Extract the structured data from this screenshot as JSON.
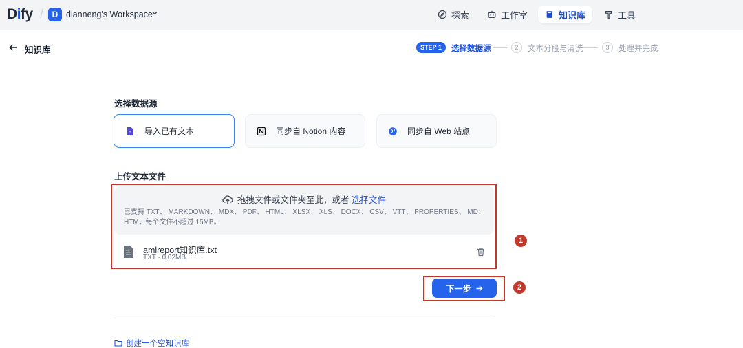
{
  "app": {
    "logo_text_pre": "D",
    "logo_text_i": "i",
    "logo_text_post": "fy"
  },
  "workspace": {
    "avatar_letter": "D",
    "name": "dianneng's Workspace"
  },
  "nav": [
    {
      "label": "探索",
      "icon": "compass-icon"
    },
    {
      "label": "工作室",
      "icon": "robot-icon"
    },
    {
      "label": "知识库",
      "icon": "book-icon",
      "active": true
    },
    {
      "label": "工具",
      "icon": "hammer-icon"
    }
  ],
  "header": {
    "page_title": "知识库"
  },
  "steps": [
    {
      "badge": "STEP 1",
      "label": "选择数据源",
      "active": true
    },
    {
      "number": "2",
      "label": "文本分段与清洗"
    },
    {
      "number": "3",
      "label": "处理并完成"
    }
  ],
  "datasource": {
    "title": "选择数据源",
    "options": [
      {
        "label": "导入已有文本",
        "icon": "document-icon",
        "selected": true
      },
      {
        "label": "同步自 Notion 内容",
        "icon": "notion-icon"
      },
      {
        "label": "同步自 Web 站点",
        "icon": "globe-icon"
      }
    ]
  },
  "upload": {
    "title": "上传文本文件",
    "drop_text": "拖拽文件或文件夹至此，或者",
    "browse_link": "选择文件",
    "supported": "已支持 TXT、 MARKDOWN、 MDX、 PDF、 HTML、 XLSX、 XLS、 DOCX、 CSV、 VTT、 PROPERTIES、 MD、 HTM，每个文件不超过 15MB。"
  },
  "file": {
    "name": "amlreport知识库.txt",
    "meta": "TXT · 0.02MB"
  },
  "annotations": {
    "marker_1": "1",
    "marker_2": "2",
    "color": "#c0392b"
  },
  "actions": {
    "next_label": "下一步",
    "create_empty": "创建一个空知识库"
  },
  "colors": {
    "primary": "#2563eb",
    "annotation": "#c0392b"
  }
}
